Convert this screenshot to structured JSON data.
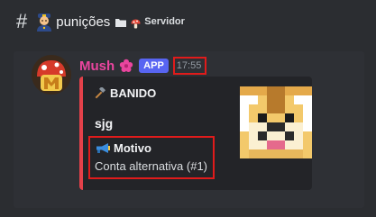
{
  "channel": {
    "hash": "#",
    "name": "punições",
    "category": "Servidor"
  },
  "message": {
    "author": "Mush",
    "badge": "APP",
    "timestamp": "17:55",
    "embed": {
      "accent_color": "#e4414a",
      "title": "BANIDO",
      "description": "sjg",
      "field": {
        "name": "Motivo",
        "value": "Conta alternativa (#1)"
      }
    }
  },
  "colors": {
    "author": "#eb459f",
    "app_badge": "#5865f2",
    "highlight": "#e01b1b"
  },
  "icons": {
    "channel": "police-officer-icon",
    "category_folder": "folder-icon",
    "category_emoji": "mushroom-icon",
    "author_badge": "flower-icon",
    "title": "hammer-icon",
    "field": "megaphone-icon"
  }
}
